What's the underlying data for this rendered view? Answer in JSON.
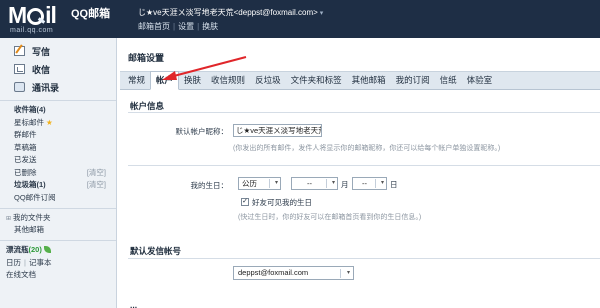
{
  "header": {
    "logo_text_1": "M",
    "logo_text_2": "il",
    "logo_cn": "QQ邮箱",
    "logo_domain": "mail.qq.com",
    "user_display": "じ★ve天涯ㄨ淡写地老天荒<deppst@foxmail.com>",
    "user_caret": "▾",
    "links": [
      "邮箱首页",
      "设置",
      "换肤"
    ]
  },
  "sidebar": {
    "main_items": [
      {
        "label": "写信",
        "icon": "compose-icon"
      },
      {
        "label": "收信",
        "icon": "inbox-icon"
      },
      {
        "label": "通讯录",
        "icon": "contacts-icon"
      }
    ],
    "folders": [
      {
        "label": "收件箱(4)",
        "bold": true,
        "action": ""
      },
      {
        "label": "星标邮件",
        "star": "★",
        "action": ""
      },
      {
        "label": "群邮件",
        "action": ""
      },
      {
        "label": "草稿箱",
        "action": ""
      },
      {
        "label": "已发送",
        "action": ""
      },
      {
        "label": "已删除",
        "action": "[清空]"
      },
      {
        "label": "垃圾箱(1)",
        "bold": true,
        "action": "[清空]"
      },
      {
        "label": "QQ邮件订阅",
        "action": ""
      }
    ],
    "group_header": "我的文件夹",
    "group_items": [
      "其他邮箱"
    ],
    "bottom": {
      "drift_label": "漂流瓶",
      "drift_count": "(20)",
      "calendar": "日历",
      "notes": "记事本",
      "docs": "在线文档"
    }
  },
  "main": {
    "page_title": "邮箱设置",
    "tabs": [
      "常规",
      "帐户",
      "换肤",
      "收信规则",
      "反垃圾",
      "文件夹和标签",
      "其他邮箱",
      "我的订阅",
      "信纸",
      "体验室"
    ],
    "active_tab_index": 1,
    "account_section_title": "帐户信息",
    "nickname_label": "默认帐户昵称：",
    "nickname_value": "じ★ve天涯ㄨ淡写地老天荒",
    "nickname_hint": "(你发出的所有邮件，发件人将显示你的邮箱昵称，你还可以给每个帐户单独设置昵称。)",
    "birthday_label": "我的生日：",
    "calendar_type": "公历",
    "month_value": "--",
    "month_unit": "月",
    "day_value": "--",
    "day_unit": "日",
    "friends_visible_label": "好友可见我的生日",
    "friends_visible_checked": "✓",
    "birthday_hint": "(快过生日时，你的好友可以在邮箱首页看到你的生日信息。)",
    "sender_section_title": "默认发信帐号",
    "sender_email": "deppst@foxmail.com",
    "next_section_title": "..."
  },
  "colors": {
    "header_bg": "#1e2e45",
    "sidebar_bg": "#eef2f6",
    "tab_bar_bg": "#dfe7ef",
    "annotation_arrow": "#e0262a"
  }
}
